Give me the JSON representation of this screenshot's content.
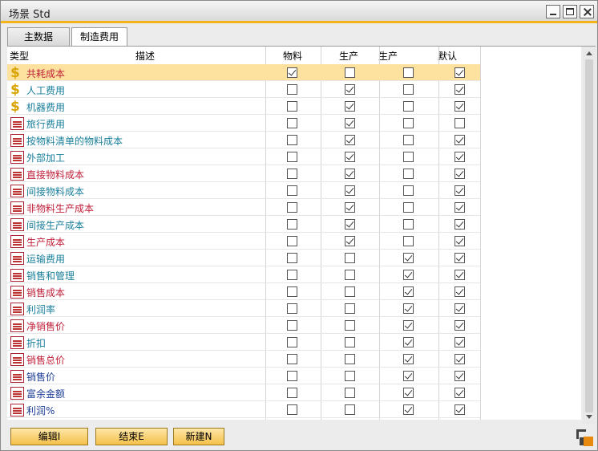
{
  "window": {
    "title": "场景 Std"
  },
  "tabs": [
    {
      "label": "主数据"
    },
    {
      "label": "制造费用"
    }
  ],
  "columns": {
    "type": "类型",
    "desc": "描述",
    "c1": "物料",
    "c2": "生产",
    "c3": "生产",
    "c4": "默认"
  },
  "rows": [
    {
      "label": "共耗成本",
      "icon": "coin",
      "color": "red",
      "checks": [
        true,
        false,
        false,
        true
      ],
      "selected": true
    },
    {
      "label": "人工费用",
      "icon": "coin",
      "color": "teal",
      "checks": [
        false,
        true,
        false,
        true
      ]
    },
    {
      "label": "机器费用",
      "icon": "coin",
      "color": "teal",
      "checks": [
        false,
        true,
        false,
        true
      ]
    },
    {
      "label": "旅行费用",
      "icon": "list",
      "color": "teal",
      "checks": [
        false,
        true,
        false,
        false
      ]
    },
    {
      "label": "按物料清单的物料成本",
      "icon": "list",
      "color": "teal",
      "checks": [
        false,
        true,
        false,
        true
      ]
    },
    {
      "label": "外部加工",
      "icon": "list",
      "color": "teal",
      "checks": [
        false,
        true,
        false,
        true
      ]
    },
    {
      "label": "直接物料成本",
      "icon": "list",
      "color": "red",
      "checks": [
        false,
        true,
        false,
        true
      ]
    },
    {
      "label": "间接物料成本",
      "icon": "list",
      "color": "teal",
      "checks": [
        false,
        true,
        false,
        true
      ]
    },
    {
      "label": "非物料生产成本",
      "icon": "list",
      "color": "red",
      "checks": [
        false,
        true,
        false,
        true
      ]
    },
    {
      "label": "间接生产成本",
      "icon": "list",
      "color": "teal",
      "checks": [
        false,
        true,
        false,
        true
      ]
    },
    {
      "label": "生产成本",
      "icon": "list",
      "color": "red",
      "checks": [
        false,
        true,
        false,
        true
      ]
    },
    {
      "label": "运输费用",
      "icon": "list",
      "color": "teal",
      "checks": [
        false,
        false,
        true,
        true
      ]
    },
    {
      "label": "销售和管理",
      "icon": "list",
      "color": "teal",
      "checks": [
        false,
        false,
        true,
        true
      ]
    },
    {
      "label": "销售成本",
      "icon": "list",
      "color": "red",
      "checks": [
        false,
        false,
        true,
        true
      ]
    },
    {
      "label": "利润率",
      "icon": "list",
      "color": "teal",
      "checks": [
        false,
        false,
        true,
        true
      ]
    },
    {
      "label": "净销售价",
      "icon": "list",
      "color": "red",
      "checks": [
        false,
        false,
        true,
        true
      ]
    },
    {
      "label": "折扣",
      "icon": "list",
      "color": "teal",
      "checks": [
        false,
        false,
        true,
        true
      ]
    },
    {
      "label": "销售总价",
      "icon": "list",
      "color": "red",
      "checks": [
        false,
        false,
        true,
        true
      ]
    },
    {
      "label": "销售价",
      "icon": "list",
      "color": "blue",
      "checks": [
        false,
        false,
        true,
        true
      ]
    },
    {
      "label": "富余金额",
      "icon": "list",
      "color": "blue",
      "checks": [
        false,
        false,
        true,
        true
      ]
    },
    {
      "label": "利润%",
      "icon": "list",
      "color": "blue",
      "checks": [
        false,
        false,
        true,
        true
      ]
    }
  ],
  "buttons": {
    "edit": "编辑I",
    "finish": "结束E",
    "new": "新建N"
  },
  "colors": {
    "accent": "#f5b418",
    "selected_row": "#fde29f",
    "button": "#f5c04a"
  },
  "icons": {
    "coin": "coin-icon",
    "list": "list-icon",
    "corner": "app-corner-icon"
  }
}
